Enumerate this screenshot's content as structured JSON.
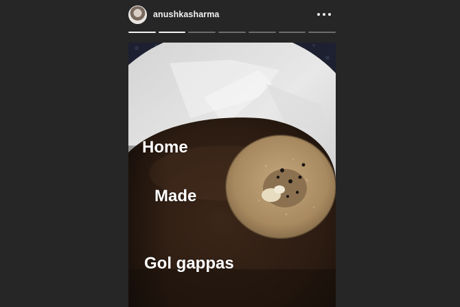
{
  "story": {
    "username": "anushkasharma",
    "more_icon": "more-horizontal-icon",
    "segments_total": 7,
    "segments_viewed": 2
  },
  "captions": {
    "line1": "Home",
    "line2": "Made",
    "line3": "Gol gappas"
  }
}
